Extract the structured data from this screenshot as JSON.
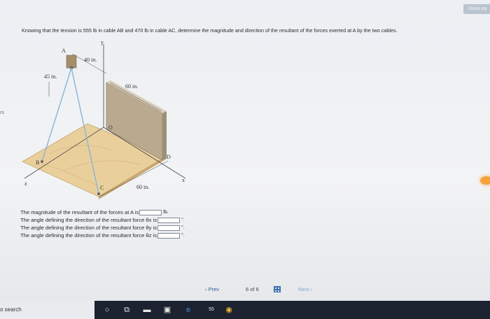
{
  "header": {
    "check_label": "Check my"
  },
  "question": {
    "text": "Knowing that the tension is 555 lb in cable AB and 470 lb in cable AC, determine the magnitude and direction of the resultant of the forces exerted at A by the two cables."
  },
  "figure": {
    "labels": {
      "y": "y",
      "A": "A",
      "d40": "40 in.",
      "d45": "45 in.",
      "d60a": "60 in.",
      "O": "O",
      "D": "D",
      "B": "B",
      "C": "C",
      "d60b": "60 in.",
      "x": "x",
      "z": "z"
    }
  },
  "side_mark": "rs",
  "answers": {
    "rows": [
      {
        "label": "The magnitude of the resultant of the forces at A is",
        "unit": "lb."
      },
      {
        "label": "The angle defining the direction of the resultant force θx is",
        "unit": "°."
      },
      {
        "label": "The angle defining the direction of the resultant force θy is",
        "unit": "°."
      },
      {
        "label": "The angle defining the direction of the resultant force θz is",
        "unit": "°."
      }
    ]
  },
  "navigation": {
    "prev": "‹  Prev",
    "counter": "6  of  6",
    "next": "Next  ›"
  },
  "taskbar": {
    "search": "o search",
    "badge": "55"
  }
}
